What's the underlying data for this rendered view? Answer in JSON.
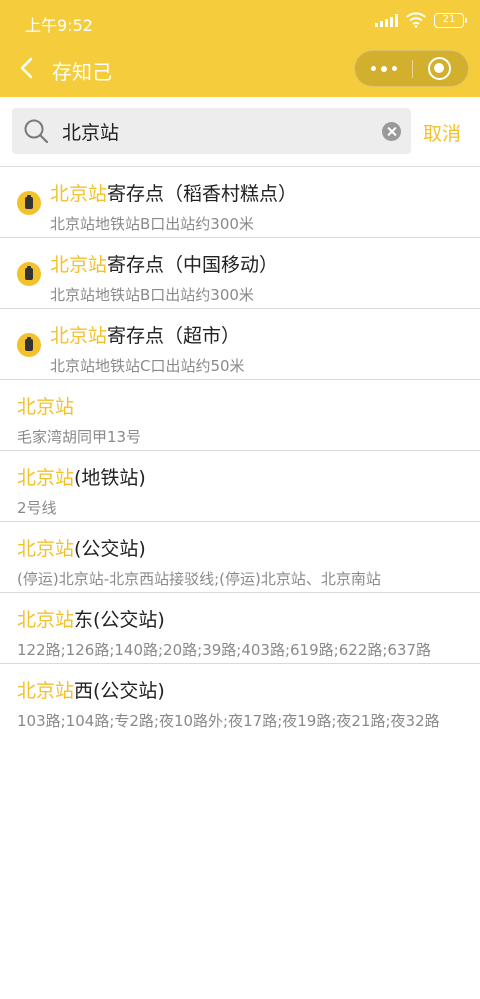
{
  "status": {
    "time": "上午9:52",
    "battery": "21"
  },
  "nav": {
    "title": "存知己"
  },
  "search": {
    "value": "北京站",
    "cancel_label": "取消"
  },
  "results": [
    {
      "type": "poi",
      "highlight": "北京站",
      "rest": "寄存点（稻香村糕点）",
      "sub": "北京站地铁站B口出站约300米"
    },
    {
      "type": "poi",
      "highlight": "北京站",
      "rest": "寄存点（中国移动）",
      "sub": "北京站地铁站B口出站约300米"
    },
    {
      "type": "poi",
      "highlight": "北京站",
      "rest": "寄存点（超市）",
      "sub": "北京站地铁站C口出站约50米"
    },
    {
      "type": "plain",
      "highlight": "北京站",
      "rest": "",
      "sub": "毛家湾胡同甲13号"
    },
    {
      "type": "plain",
      "highlight": "北京站",
      "rest": "(地铁站)",
      "sub": "2号线"
    },
    {
      "type": "plain",
      "highlight": "北京站",
      "rest": "(公交站)",
      "sub": "(停运)北京站-北京西站接驳线;(停运)北京站、北京南站"
    },
    {
      "type": "plain",
      "highlight": "北京站",
      "rest": "东(公交站)",
      "sub": "122路;126路;140路;20路;39路;403路;619路;622路;637路"
    },
    {
      "type": "plain",
      "highlight": "北京站",
      "rest": "西(公交站)",
      "sub": "103路;104路;专2路;夜10路外;夜17路;夜19路;夜21路;夜32路"
    }
  ],
  "colors": {
    "brand": "#f5cd3c",
    "highlight": "#f3c12c"
  }
}
